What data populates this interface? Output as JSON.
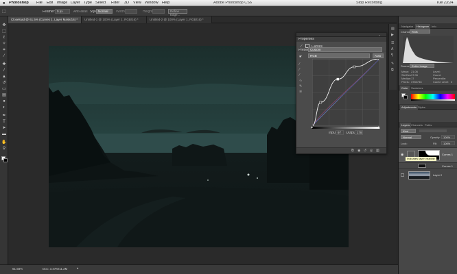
{
  "menubar": {
    "app": "Photoshop",
    "items": [
      "File",
      "Edit",
      "Image",
      "Layer",
      "Type",
      "Select",
      "Filter",
      "3D",
      "View",
      "Window",
      "Help"
    ],
    "window_title": "Adobe Photoshop CS6",
    "recording": "Stop Recording",
    "clock": "Tue 23:24"
  },
  "options": {
    "feather_label": "Feather:",
    "feather_value": "0 px",
    "anti_alias": "Anti-alias",
    "style_label": "Style:",
    "style_value": "Normal",
    "width_label": "Width:",
    "height_label": "Height:",
    "refine_edge": "Refine Edge..."
  },
  "tabs": [
    "Closeload @ 61.5% (Curves 1, Layer Mask/16) *",
    "Untitled-1 @ 100% (Layer 1, RGB/16) *",
    "Untitled-2 @ 100% (Layer 1, RGB/16) *"
  ],
  "status": {
    "zoom": "61.58%",
    "doc": "Doc: 3.47M/11.2M"
  },
  "properties": {
    "title": "Properties",
    "layer_name": "Curves",
    "preset_label": "Preset:",
    "preset_value": "Custom",
    "channel_value": "RGB",
    "auto": "Auto",
    "input_label": "Input:",
    "input_value": "97",
    "output_label": "Output:",
    "output_value": "178"
  },
  "navigator": {
    "tabs": [
      "Navigator",
      "Histogram",
      "Info"
    ],
    "channel_label": "Channel:",
    "channel_value": "RGB",
    "source_label": "Source:",
    "source_value": "Entire Image",
    "stats": [
      [
        "Mean:",
        "21.06",
        "Level:",
        ""
      ],
      [
        "Std Dev:",
        "17.06",
        "Count:",
        ""
      ],
      [
        "Median:",
        "17",
        "Percentile:",
        ""
      ],
      [
        "Pixels:",
        "3783746",
        "Cache Level:",
        "3"
      ]
    ]
  },
  "color": {
    "tabs": [
      "Color",
      "Swatches"
    ]
  },
  "adjustments": {
    "tabs": [
      "Adjustments",
      "Styles"
    ]
  },
  "layers": {
    "tabs": [
      "Layers",
      "Channels",
      "Paths"
    ],
    "kind": "Kind",
    "blend": "Normal",
    "opacity_label": "Opacity:",
    "opacity_value": "100%",
    "lock_label": "Lock:",
    "fill_label": "Fill:",
    "fill_value": "100%",
    "items": [
      {
        "name": "Curves 1",
        "tooltip": "Indicates layer visibility"
      },
      {
        "name": "Curves 1"
      },
      {
        "name": "Layer 0"
      }
    ]
  },
  "colors": {
    "accent": "#2e6fc0",
    "ui_dark": "#3a3a3a",
    "photo_sky": "#1f3836"
  },
  "chart_data": {
    "type": "line",
    "series": [
      {
        "x": [
          0,
          32,
          97,
          160,
          255
        ],
        "y": [
          0,
          90,
          178,
          225,
          255
        ]
      }
    ],
    "xlim": [
      0,
      255
    ],
    "ylim": [
      0,
      255
    ]
  },
  "icons": [
    "apple-icon",
    "marquee-icon",
    "move-icon",
    "lasso-icon",
    "wand-icon",
    "crop-icon",
    "eyedropper-icon",
    "healing-icon",
    "brush-icon",
    "stamp-icon",
    "history-brush-icon",
    "eraser-icon",
    "gradient-icon",
    "blur-icon",
    "dodge-icon",
    "pen-icon",
    "type-icon",
    "path-select-icon",
    "shape-icon",
    "hand-icon",
    "zoom-icon",
    "eye-icon",
    "curves-icon"
  ]
}
